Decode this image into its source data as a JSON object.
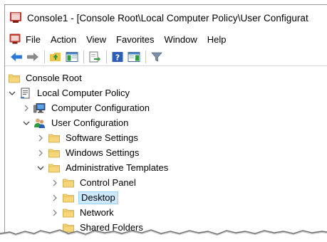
{
  "window": {
    "title": "Console1 - [Console Root\\Local Computer Policy\\User Configurat",
    "app_icon": "mmc-console-icon"
  },
  "menubar": {
    "items": [
      "File",
      "Action",
      "View",
      "Favorites",
      "Window",
      "Help"
    ]
  },
  "toolbar": {
    "buttons": [
      "back-arrow-icon",
      "forward-arrow-icon",
      "up-folder-icon",
      "show-hide-console-tree-icon",
      "export-list-icon",
      "help-icon",
      "show-hide-action-pane-icon",
      "filter-icon"
    ]
  },
  "tree": {
    "items": [
      {
        "label": "Console Root",
        "icon": "folder-icon",
        "expander": "none"
      },
      {
        "label": "Local Computer Policy",
        "icon": "policy-document-icon",
        "expander": "expanded"
      },
      {
        "label": "Computer Configuration",
        "icon": "computer-icon",
        "expander": "collapsed"
      },
      {
        "label": "User Configuration",
        "icon": "users-icon",
        "expander": "expanded"
      },
      {
        "label": "Software Settings",
        "icon": "folder-icon",
        "expander": "collapsed"
      },
      {
        "label": "Windows Settings",
        "icon": "folder-icon",
        "expander": "collapsed"
      },
      {
        "label": "Administrative Templates",
        "icon": "folder-icon",
        "expander": "expanded"
      },
      {
        "label": "Control Panel",
        "icon": "folder-icon",
        "expander": "collapsed"
      },
      {
        "label": "Desktop",
        "icon": "folder-icon",
        "expander": "collapsed",
        "selected": true
      },
      {
        "label": "Network",
        "icon": "folder-icon",
        "expander": "collapsed"
      },
      {
        "label": "Shared Folders",
        "icon": "folder-icon",
        "expander": "none"
      }
    ]
  },
  "colors": {
    "selection_fill": "#cce8ff",
    "selection_border": "#99d1ff",
    "folder_yellow": "#f7d57a",
    "arrow_blue": "#2b78d6"
  }
}
